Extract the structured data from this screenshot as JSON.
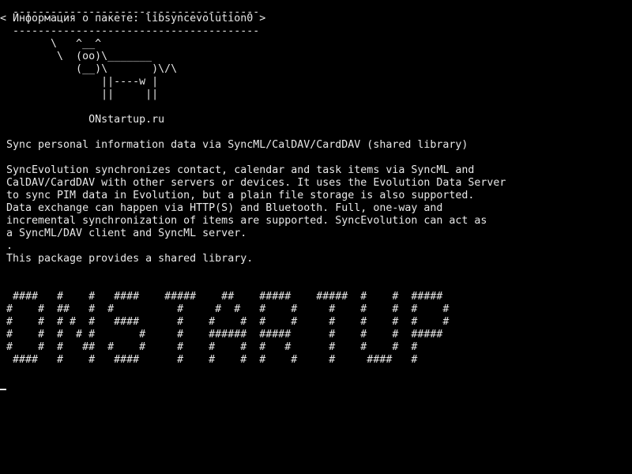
{
  "terminal": {
    "cowsay": {
      "border_top": " ---------------------------------------",
      "message": "< Информация о пакете: libsyncevolution0 >",
      "border_bottom": " ---------------------------------------",
      "cow": [
        "       \\   ^__^",
        "        \\  (oo)\\_______",
        "           (__)\\       )\\/\\",
        "               ||----w |",
        "               ||     ||"
      ]
    },
    "brand": "             ONstartup.ru",
    "summary": "Sync personal information data via SyncML/CalDAV/CardDAV (shared library)",
    "description": [
      "SyncEvolution synchronizes contact, calendar and task items via SyncML and",
      "CalDAV/CardDAV with other servers or devices. It uses the Evolution Data Server",
      "to sync PIM data in Evolution, but a plain file storage is also supported.",
      "Data exchange can happen via HTTP(S) and Bluetooth. Full, one-way and",
      "incremental synchronization of items are supported. SyncEvolution can act as",
      "a SyncML/DAV client and SyncML server.",
      ".",
      "This package provides a shared library."
    ],
    "banner": [
      " ####   #    #   ####    #####    ##    #####    #####  #    #  #####",
      "#    #  ##   #  #          #     #  #   #    #     #    #    #  #    #",
      "#    #  # #  #   ####      #    #    #  #    #     #    #    #  #    #",
      "#    #  #  # #       #     #    ######  #####      #    #    #  #####",
      "#    #  #   ##  #    #     #    #    #  #   #      #    #    #  #",
      " ####   #    #   ####      #    #    #  #    #     #     ####   #"
    ]
  }
}
